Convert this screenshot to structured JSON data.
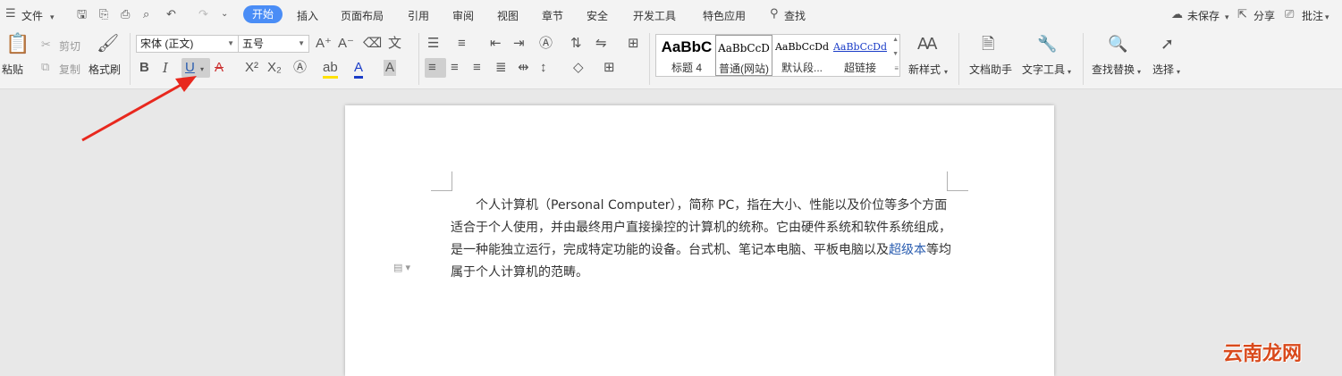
{
  "menu": {
    "file": "文件",
    "tabs": [
      "开始",
      "插入",
      "页面布局",
      "引用",
      "审阅",
      "视图",
      "章节",
      "安全",
      "开发工具",
      "特色应用"
    ],
    "search": "查找",
    "unsaved": "未保存",
    "share": "分享",
    "comment": "批注"
  },
  "ribbon": {
    "paste": "粘贴",
    "cut": "剪切",
    "copy": "复制",
    "format_painter": "格式刷",
    "font_name": "宋体 (正文)",
    "font_size": "五号",
    "bold": "B",
    "italic": "I",
    "underline": "U",
    "styles": [
      {
        "sample": "AaBbC",
        "name": "标题 4"
      },
      {
        "sample": "AaBbCcD",
        "name": "普通(网站)"
      },
      {
        "sample": "AaBbCcDd",
        "name": "默认段..."
      },
      {
        "sample": "AaBbCcDd",
        "name": "超链接"
      }
    ],
    "new_style": "新样式",
    "doc_assistant": "文档助手",
    "text_tools": "文字工具",
    "find_replace": "查找替换",
    "select": "选择"
  },
  "document": {
    "text_before_link": "个人计算机（Personal Computer），简称 PC，指在大小、性能以及价位等多个方面适合于个人使用，并由最终用户直接操控的计算机的统称。它由硬件系统和软件系统组成，是一种能独立运行，完成特定功能的设备。台式机、笔记本电脑、平板电脑以及",
    "link_text": "超级本",
    "text_after_link": "等均属于个人计算机的范畴。"
  },
  "watermark": "云南龙网",
  "colors": {
    "accent": "#4a8df6",
    "arrow": "#e8281e",
    "link": "#2a5db0"
  }
}
